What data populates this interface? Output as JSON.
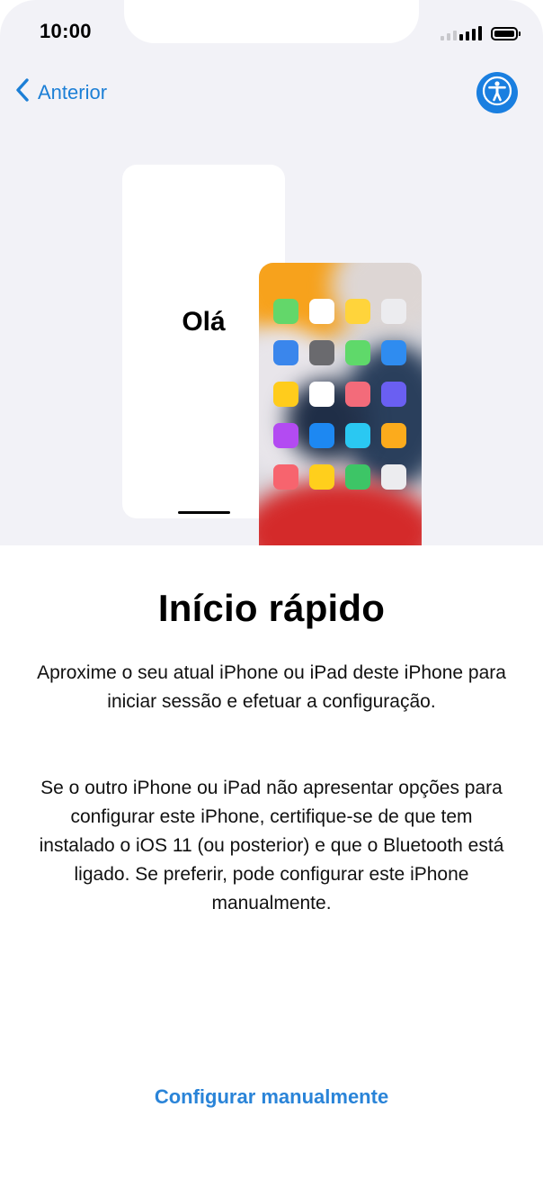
{
  "status_bar": {
    "time": "10:00",
    "icons": [
      "signal-icon",
      "battery-icon"
    ]
  },
  "nav": {
    "back_label": "Anterior",
    "back_icon": "chevron-left-icon",
    "accessibility_icon": "accessibility-icon"
  },
  "illustration": {
    "hello_text": "Olá"
  },
  "content": {
    "title": "Início rápido",
    "paragraph1": "Aproxime o seu atual iPhone ou iPad deste iPhone para iniciar sessão e efetuar a configuração.",
    "paragraph2": "Se o outro iPhone ou iPad não apresentar opções para configurar este iPhone, certifique-se de que tem instalado o iOS 11 (ou posterior) e que o Bluetooth está ligado. Se preferir, pode configurar este iPhone manualmente."
  },
  "actions": {
    "manual_setup": "Configurar manualmente"
  },
  "colors": {
    "accent": "#1c7fd6",
    "background_top": "#f2f2f7"
  }
}
